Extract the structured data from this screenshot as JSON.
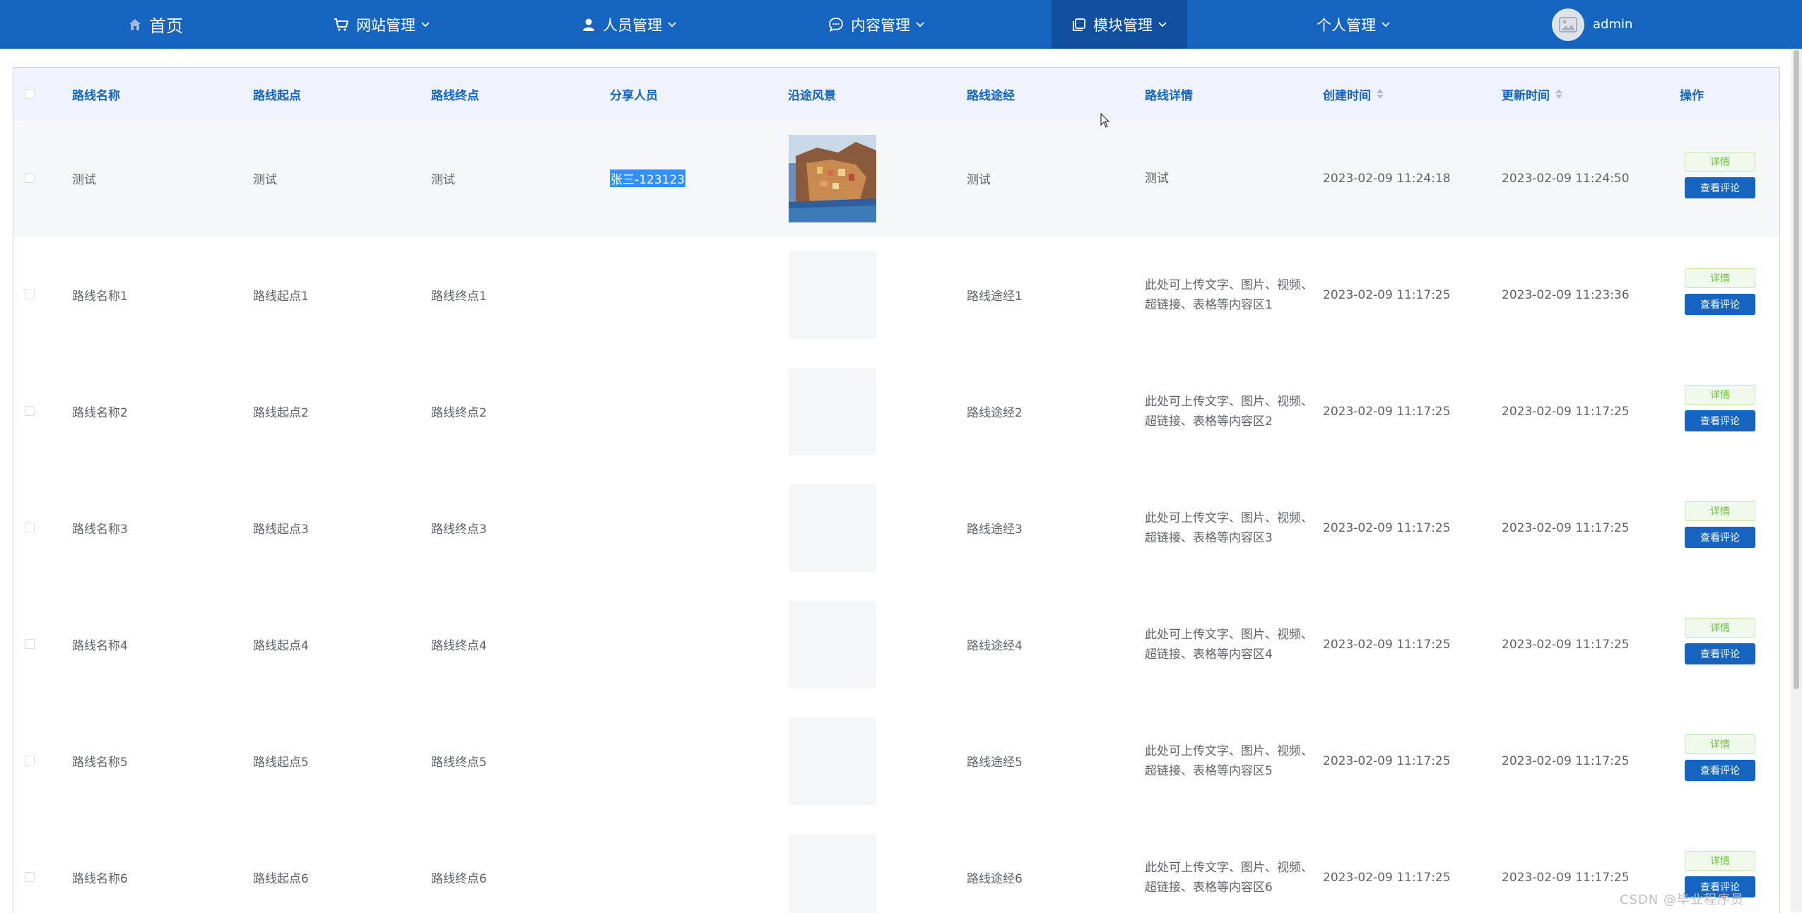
{
  "nav": {
    "home": "首页",
    "items": [
      {
        "label": "网站管理",
        "icon": "cart-icon"
      },
      {
        "label": "人员管理",
        "icon": "user-icon"
      },
      {
        "label": "内容管理",
        "icon": "chat-icon"
      },
      {
        "label": "模块管理",
        "icon": "module-icon",
        "active": true
      },
      {
        "label": "个人管理",
        "icon": "none"
      }
    ],
    "user": "admin"
  },
  "table": {
    "headers": [
      "路线名称",
      "路线起点",
      "路线终点",
      "分享人员",
      "沿途风景",
      "路线途经",
      "路线详情",
      "创建时间",
      "更新时间",
      "操作"
    ],
    "detail_button": "详情",
    "comment_button": "查看评论",
    "rows": [
      {
        "name": "测试",
        "start": "测试",
        "end": "测试",
        "sharer": "张三-123123",
        "via": "测试",
        "detail": "测试",
        "created": "2023-02-09 11:24:18",
        "updated": "2023-02-09 11:24:50"
      },
      {
        "name": "路线名称1",
        "start": "路线起点1",
        "end": "路线终点1",
        "sharer": "",
        "via": "路线途经1",
        "detail": "此处可上传文字、图片、视频、超链接、表格等内容区1",
        "created": "2023-02-09 11:17:25",
        "updated": "2023-02-09 11:23:36"
      },
      {
        "name": "路线名称2",
        "start": "路线起点2",
        "end": "路线终点2",
        "sharer": "",
        "via": "路线途经2",
        "detail": "此处可上传文字、图片、视频、超链接、表格等内容区2",
        "created": "2023-02-09 11:17:25",
        "updated": "2023-02-09 11:17:25"
      },
      {
        "name": "路线名称3",
        "start": "路线起点3",
        "end": "路线终点3",
        "sharer": "",
        "via": "路线途经3",
        "detail": "此处可上传文字、图片、视频、超链接、表格等内容区3",
        "created": "2023-02-09 11:17:25",
        "updated": "2023-02-09 11:17:25"
      },
      {
        "name": "路线名称4",
        "start": "路线起点4",
        "end": "路线终点4",
        "sharer": "",
        "via": "路线途经4",
        "detail": "此处可上传文字、图片、视频、超链接、表格等内容区4",
        "created": "2023-02-09 11:17:25",
        "updated": "2023-02-09 11:17:25"
      },
      {
        "name": "路线名称5",
        "start": "路线起点5",
        "end": "路线终点5",
        "sharer": "",
        "via": "路线途经5",
        "detail": "此处可上传文字、图片、视频、超链接、表格等内容区5",
        "created": "2023-02-09 11:17:25",
        "updated": "2023-02-09 11:17:25"
      },
      {
        "name": "路线名称6",
        "start": "路线起点6",
        "end": "路线终点6",
        "sharer": "",
        "via": "路线途经6",
        "detail": "此处可上传文字、图片、视频、超链接、表格等内容区6",
        "created": "2023-02-09 11:17:25",
        "updated": "2023-02-09 11:17:25"
      }
    ]
  },
  "watermark": "CSDN @毕业程序员"
}
